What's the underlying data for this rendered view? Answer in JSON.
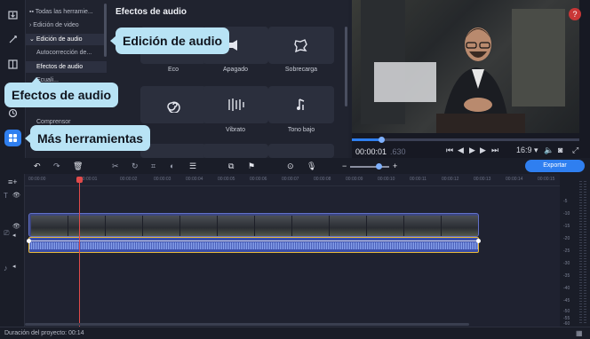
{
  "rail": {
    "icons": [
      "import-icon",
      "magic-wand-icon",
      "transitions-icon",
      "titles-icon",
      "stickers-icon",
      "history-icon",
      "more-tools-icon"
    ]
  },
  "tree": {
    "items": [
      "Todas las herramie...",
      "Edición de video",
      "Edición de audio",
      "Autocorrección de...",
      "Efectos de audio",
      "Ecuali...",
      "Comprensor"
    ]
  },
  "effects": {
    "title": "Efectos de audio",
    "cards": [
      {
        "label": "Eco",
        "icon": "echo-icon"
      },
      {
        "label": "Apagado",
        "icon": "muffled-icon"
      },
      {
        "label": "Sobrecarga",
        "icon": "overload-icon"
      },
      {
        "label": "",
        "icon": "spiral-icon"
      },
      {
        "label": "Vibrato",
        "icon": "vibrato-icon"
      },
      {
        "label": "Tono bajo",
        "icon": "low-tone-icon"
      }
    ]
  },
  "preview": {
    "timecode": "00:00:01",
    "timecode_dim": ".630",
    "speed": "16:9",
    "help": "?"
  },
  "toolbar": {
    "export_label": "Exportar"
  },
  "ruler": {
    "ticks": [
      "00:00:00",
      "00:00:01",
      "00:00:02",
      "00:00:03",
      "00:00:04",
      "00:00:05",
      "00:00:06",
      "00:00:07",
      "00:00:08",
      "00:00:09",
      "00:00:10",
      "00:00:11",
      "00:00:12",
      "00:00:13",
      "00:00:14",
      "00:00:15"
    ]
  },
  "meter": {
    "ticks": [
      "-5",
      "-10",
      "-15",
      "-20",
      "-25",
      "-30",
      "-35",
      "-40",
      "-45",
      "-50",
      "-55",
      "-60"
    ]
  },
  "status": {
    "text": "Duración del proyecto: 00:14"
  },
  "tooltips": {
    "audio_edit": "Edición de audio",
    "audio_effects": "Efectos de audio",
    "more_tools": "Más herramientas"
  },
  "colors": {
    "accent": "#2f7ff0",
    "tooltip": "#b8e3f5",
    "playhead": "#e04a4a",
    "audio_border": "#e6b93b"
  }
}
